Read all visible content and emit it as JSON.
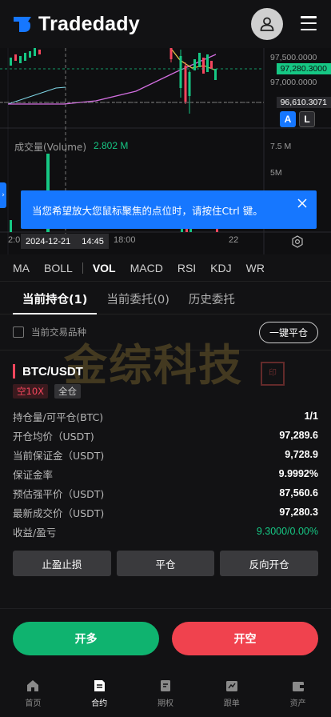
{
  "app": {
    "name": "Tradedady"
  },
  "chart": {
    "price_labels": [
      "97,500.0000",
      "97,000.0000"
    ],
    "current_price": "97,280.3000",
    "low_price": "96,610.3071",
    "btn_a": "A",
    "btn_l": "L",
    "volume_label": "成交量(Volume)",
    "volume_value": "2.802 M",
    "volume_axis": [
      "7.5 M",
      "5M"
    ],
    "x_ticks": [
      "2:0",
      "18:00",
      "22"
    ],
    "crosshair_date": "2024-12-21",
    "crosshair_time": "14:45",
    "toast": "当您希望放大您鼠标聚焦的点位时，请按住Ctrl 键。",
    "accent": "#1677ff",
    "up_color": "#16c784",
    "down_color": "#f6465d"
  },
  "indicators": [
    "MA",
    "BOLL",
    "VOL",
    "MACD",
    "RSI",
    "KDJ",
    "WR"
  ],
  "tabs": [
    "当前持仓(1)",
    "当前委托(0)",
    "历史委托"
  ],
  "filter": {
    "label": "当前交易品种",
    "close_all": "一键平仓"
  },
  "watermark": "金综科技",
  "position": {
    "pair": "BTC/USDT",
    "side_badge": "空10X",
    "margin_badge": "全仓",
    "rows": [
      {
        "k": "持仓量/可平仓(BTC)",
        "v": "1/1"
      },
      {
        "k": "开仓均价（USDT)",
        "v": "97,289.6"
      },
      {
        "k": "当前保证金（USDT)",
        "v": "9,728.9"
      },
      {
        "k": "保证金率",
        "v": "9.9992%"
      },
      {
        "k": "预估强平价（USDT)",
        "v": "87,560.6"
      },
      {
        "k": "最新成交价（USDT)",
        "v": "97,280.3"
      },
      {
        "k": "收益/盈亏",
        "v": "9.3000/0.00%"
      }
    ],
    "actions": [
      "止盈止损",
      "平仓",
      "反向开仓"
    ]
  },
  "trade": {
    "long": "开多",
    "short": "开空"
  },
  "nav": [
    "首页",
    "合约",
    "期权",
    "跟单",
    "资产"
  ]
}
